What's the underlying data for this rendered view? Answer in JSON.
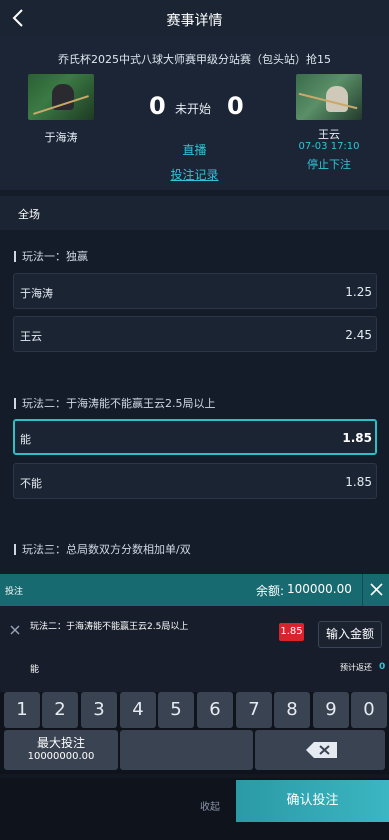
{
  "header": {
    "title": "赛事详情"
  },
  "match": {
    "league": "乔氏杯2025中式八球大师赛甲级分站赛（包头站）抢15",
    "home_name": "于海涛",
    "away_name": "王云",
    "home_score": "0",
    "away_score": "0",
    "status": "未开始",
    "date": "07-03 17:10",
    "stop_text": "停止下注",
    "live_label": "直播",
    "record_label": "投注记录"
  },
  "section": {
    "label": "全场"
  },
  "plays": [
    {
      "title": "玩法一：独赢",
      "options": [
        {
          "name": "于海涛",
          "odds": "1.25"
        },
        {
          "name": "王云",
          "odds": "2.45"
        }
      ]
    },
    {
      "title": "玩法二：于海涛能不能赢王云2.5局以上",
      "options": [
        {
          "name": "能",
          "odds": "1.85"
        },
        {
          "name": "不能",
          "odds": "1.85"
        }
      ]
    },
    {
      "title": "玩法三：总局数双方分数相加单/双",
      "options": []
    }
  ],
  "betslip": {
    "label": "投注",
    "balance_label": "余额:",
    "balance_value": "100000.00",
    "item_name": "玩法二：于海涛能不能赢王云2.5局以上",
    "item_odds": "1.85",
    "amount_placeholder": "输入金额",
    "selection": "能",
    "return_label": "预计返还",
    "return_value": "0"
  },
  "keypad": {
    "digits": [
      "1",
      "2",
      "3",
      "4",
      "5",
      "6",
      "7",
      "8",
      "9",
      "0"
    ],
    "max_label": "最大投注",
    "max_value": "10000000.00"
  },
  "footer": {
    "fold_label": "收起",
    "confirm_label": "确认投注"
  },
  "colors": {
    "accent": "#2fc4d6",
    "odds_badge": "#d9232d",
    "header_bar": "#176a6f"
  }
}
